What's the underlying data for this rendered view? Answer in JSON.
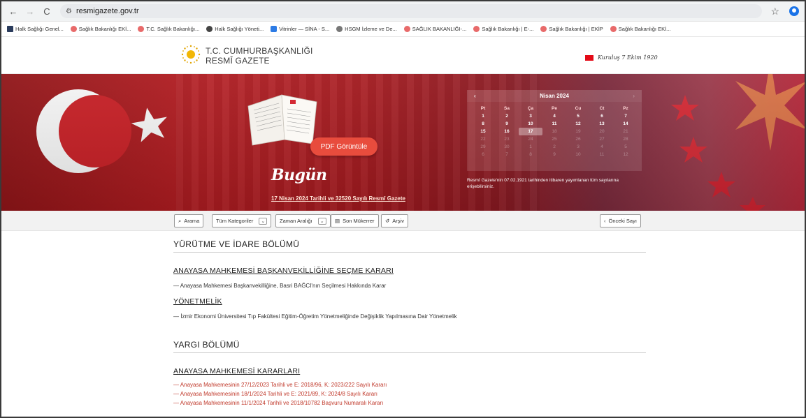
{
  "browser": {
    "url": "resmigazete.gov.tr",
    "bookmarks": [
      "Halk Sağlığı Genel...",
      "Sağlık Bakanlığı EKİ...",
      "T.C. Sağlık Bakanlığı...",
      "Halk Sağlığı Yöneti...",
      "Vitrinler — SİNA - S...",
      "HSGM İzleme ve De...",
      "SAĞLIK BAKANLIĞI-...",
      "Sağlık Bakanlığı | E-...",
      "Sağlık Bakanlığı | EKİP",
      "Sağlık Bakanlığı EKİ..."
    ]
  },
  "header": {
    "org_line1": "T.C. CUMHURBAŞKANLIĞI",
    "org_line2": "RESMÎ GAZETE",
    "founding": "Kuruluş 7 Ekim 1920"
  },
  "hero": {
    "pdf_button": "PDF Görüntüle",
    "today_title": "Bugün",
    "today_link": "17 Nisan 2024 Tarihli ve 32520 Sayılı Resmî Gazete",
    "calendar": {
      "month": "Nisan 2024",
      "prev": "‹",
      "next": "›",
      "weekdays": [
        "Pt",
        "Sa",
        "Ça",
        "Pe",
        "Cu",
        "Ct",
        "Pz"
      ],
      "weeks": [
        [
          "1",
          "2",
          "3",
          "4",
          "5",
          "6",
          "7"
        ],
        [
          "8",
          "9",
          "10",
          "11",
          "12",
          "13",
          "14"
        ],
        [
          "15",
          "16",
          "17",
          "18",
          "19",
          "20",
          "21"
        ],
        [
          "22",
          "23",
          "24",
          "25",
          "26",
          "27",
          "28"
        ],
        [
          "29",
          "30",
          "1",
          "2",
          "3",
          "4",
          "5"
        ],
        [
          "6",
          "7",
          "8",
          "9",
          "10",
          "11",
          "12"
        ]
      ],
      "selected_day": "17"
    },
    "calendar_note": "Resmî Gazete'nin 07.02.1921 tarihinden itibaren yayımlanan tüm sayılarına erişebilirsiniz."
  },
  "toolbar": {
    "search": "Arama",
    "categories": "Tüm Kategoriler",
    "date_range": "Zaman Aralığı",
    "last_repeat": "Son Mükerrer",
    "archive": "Arşiv",
    "prev_issue": "Önceki Sayı"
  },
  "sections": [
    {
      "title": "YÜRÜTME VE İDARE BÖLÜMÜ",
      "groups": [
        {
          "title": "ANAYASA MAHKEMESİ BAŞKANVEKİLLİĞİNE SEÇME KARARI",
          "entries": [
            "— Anayasa Mahkemesi Başkanvekilliğine, Basri BAĞCI'nın Seçilmesi Hakkında Karar"
          ]
        },
        {
          "title": "YÖNETMELİK",
          "entries": [
            "— İzmir Ekonomi Üniversitesi Tıp Fakültesi Eğitim-Öğretim Yönetmeliğinde Değişiklik Yapılmasına Dair Yönetmelik"
          ]
        }
      ]
    },
    {
      "title": "YARGI BÖLÜMÜ",
      "groups": [
        {
          "title": "ANAYASA MAHKEMESİ KARARLARI",
          "entries": [
            "— Anayasa Mahkemesinin 27/12/2023 Tarihli ve E: 2018/96, K: 2023/222 Sayılı Kararı",
            "— Anayasa Mahkemesinin 18/1/2024 Tarihli ve E: 2021/89, K: 2024/8 Sayılı Kararı",
            "— Anayasa Mahkemesinin 11/1/2024 Tarihli ve 2018/10782 Başvuru Numaralı Kararı"
          ]
        }
      ]
    }
  ],
  "colors": {
    "hero_red": "#b41d22",
    "pdf_button": "#e84c3d",
    "court_links": "#c0392b"
  }
}
